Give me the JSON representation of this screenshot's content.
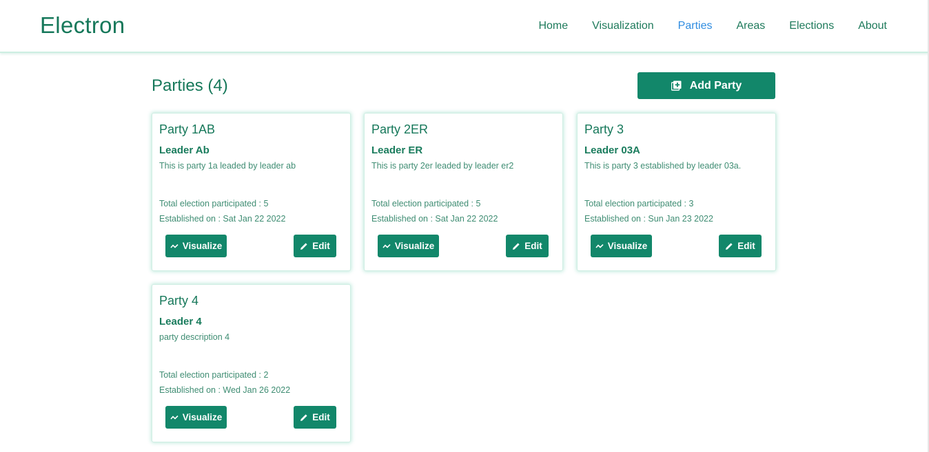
{
  "header": {
    "brand": "Electron",
    "nav": [
      {
        "label": "Home",
        "active": false
      },
      {
        "label": "Visualization",
        "active": false
      },
      {
        "label": "Parties",
        "active": true
      },
      {
        "label": "Areas",
        "active": false
      },
      {
        "label": "Elections",
        "active": false
      },
      {
        "label": "About",
        "active": false
      }
    ]
  },
  "main": {
    "title": "Parties (4)",
    "add_button_label": "Add Party",
    "add_button_icon": "add-box-icon",
    "parties": [
      {
        "name": "Party 1AB",
        "leader": "Leader Ab",
        "description": "This is party 1a leaded by leader ab",
        "total": "Total election participated : 5",
        "established": "Established on : Sat Jan 22 2022",
        "visualize_label": "Visualize",
        "edit_label": "Edit"
      },
      {
        "name": "Party 2ER",
        "leader": "Leader ER",
        "description": "This is party 2er leaded by leader er2",
        "total": "Total election participated : 5",
        "established": "Established on : Sat Jan 22 2022",
        "visualize_label": "Visualize",
        "edit_label": "Edit"
      },
      {
        "name": "Party 3",
        "leader": "Leader 03A",
        "description": "This is party 3 established by leader 03a.",
        "total": "Total election participated : 3",
        "established": "Established on : Sun Jan 23 2022",
        "visualize_label": "Visualize",
        "edit_label": "Edit"
      },
      {
        "name": "Party 4",
        "leader": "Leader 4",
        "description": "party description 4",
        "total": "Total election participated : 2",
        "established": "Established on : Wed Jan 26 2022",
        "visualize_label": "Visualize",
        "edit_label": "Edit"
      }
    ]
  },
  "colors": {
    "primary": "#12876a",
    "text": "#16785a",
    "active_nav": "#2f8ce0"
  }
}
